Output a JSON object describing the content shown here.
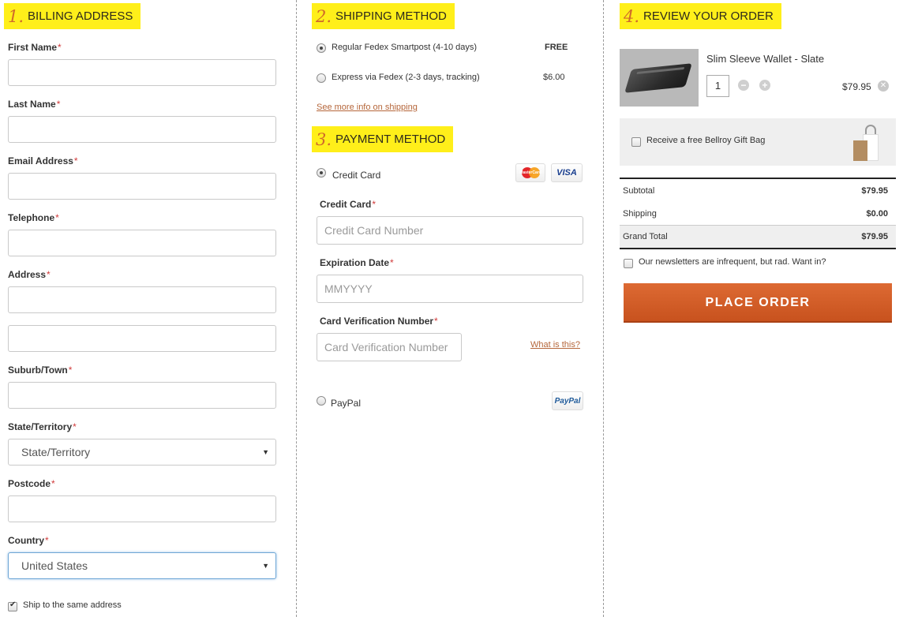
{
  "billing": {
    "number": "1.",
    "title": "BILLING ADDRESS",
    "first_name_label": "First Name",
    "last_name_label": "Last Name",
    "email_label": "Email Address",
    "telephone_label": "Telephone",
    "address_label": "Address",
    "suburb_label": "Suburb/Town",
    "state_label": "State/Territory",
    "state_value": "State/Territory",
    "postcode_label": "Postcode",
    "country_label": "Country",
    "country_value": "United States",
    "ship_same_label": "Ship to the same address",
    "required_mark": "*"
  },
  "shipping": {
    "number": "2.",
    "title": "SHIPPING METHOD",
    "options": [
      {
        "label": "Regular Fedex Smartpost (4-10 days)",
        "price": "FREE",
        "selected": true
      },
      {
        "label": "Express via Fedex (2-3 days, tracking)",
        "price": "$6.00",
        "selected": false
      }
    ],
    "more_info_link": "See more info on shipping"
  },
  "payment": {
    "number": "3.",
    "title": "PAYMENT METHOD",
    "credit_card_option": "Credit Card",
    "mastercard_text": "MasterCard",
    "visa_text": "VISA",
    "card_label": "Credit Card",
    "card_placeholder": "Credit Card Number",
    "expiry_label": "Expiration Date",
    "expiry_placeholder": "MMYYYY",
    "cvv_label": "Card Verification Number",
    "cvv_placeholder": "Card Verification Number",
    "what_is_this": "What is this?",
    "paypal_option": "PayPal",
    "paypal_logo": "PayPal"
  },
  "review": {
    "number": "4.",
    "title": "REVIEW YOUR ORDER",
    "product_name": "Slim Sleeve Wallet - Slate",
    "quantity": "1",
    "product_price": "$79.95",
    "gift_label": "Receive a free Bellroy Gift Bag",
    "subtotal_label": "Subtotal",
    "subtotal_value": "$79.95",
    "shipping_label": "Shipping",
    "shipping_value": "$0.00",
    "grand_total_label": "Grand Total",
    "grand_total_value": "$79.95",
    "newsletter_label": "Our newsletters are infrequent, but rad. Want in?",
    "place_order": "PLACE ORDER"
  },
  "colors": {
    "highlight": "#ffef1a",
    "number_accent": "#d06a2a",
    "button": "#d5602a",
    "link": "#b5663a"
  }
}
